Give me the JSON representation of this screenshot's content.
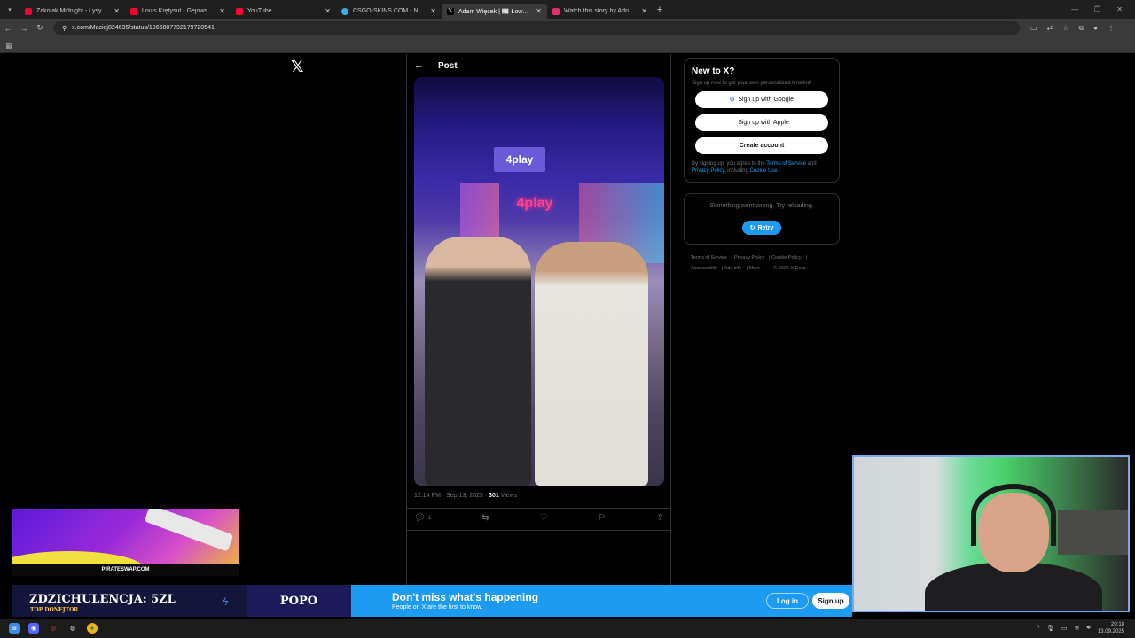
{
  "tabs": [
    {
      "title": "Zakolak Midnight - Łysy Wojow",
      "color": "#ff0033",
      "active": false
    },
    {
      "title": "Louis Krętysut - Gejowski Blum",
      "color": "#ff0033",
      "active": false
    },
    {
      "title": "YouTube",
      "color": "#ff0033",
      "active": false
    },
    {
      "title": "CSGO-SKINS.COM - Najlepsze",
      "color": "#3ab0e0",
      "active": false
    },
    {
      "title": "Adam Więcek | 📰 Łowca faktó",
      "color": "#ffffff",
      "active": true
    },
    {
      "title": "Watch this story by Adrian Cio",
      "color": "#e1306c",
      "active": false
    }
  ],
  "browser": {
    "url": "x.com/Maciej824635/status/1966807792179720541",
    "new_tab": "+",
    "close_glyph": "✕"
  },
  "post": {
    "header_title": "Post",
    "photo_sign": "4play",
    "photo_neon": "4play",
    "timestamp": "12:14 PM · Sep 13, 2025 · ",
    "views_count": "301",
    "views_label": " Views",
    "reply_count": "1"
  },
  "sidebar": {
    "new_to_x_title": "New to X?",
    "subtitle": "Sign up now to get your own personalized timeline!",
    "google_btn": "Sign up with Google",
    "apple_btn": "Sign up with Apple",
    "create_btn": "Create account",
    "legal_prefix": "By signing up, you agree to the ",
    "terms_link": "Terms of Service",
    "legal_and": " and ",
    "privacy_link": "Privacy Policy",
    "legal_including": ", including ",
    "cookie_link": "Cookie Use",
    "legal_end": ".",
    "error_text": "Something went wrong. Try reloading.",
    "retry_btn": "Retry",
    "footer": [
      "Terms of Service",
      "Privacy Policy",
      "Cookie Policy",
      "Accessibility",
      "Ads info",
      "More ···",
      "© 2025 X Corp."
    ]
  },
  "banner": {
    "title": "Don't miss what's happening",
    "subtitle": "People on X are the first to know.",
    "login": "Log in",
    "signup": "Sign up"
  },
  "overlays": {
    "ad_brand": "PIRATESWAP.COM",
    "donor_big": "ZDZICHULENCJA: 5ZL",
    "donor_small": "TOP DONEJTOR",
    "popo": "POPO"
  },
  "taskbar": {
    "time": "20:18",
    "date": "13.09.2025"
  },
  "colors": {
    "accent": "#1d9bf0",
    "background": "#000000",
    "border": "#2f3336",
    "muted": "#71767b"
  }
}
